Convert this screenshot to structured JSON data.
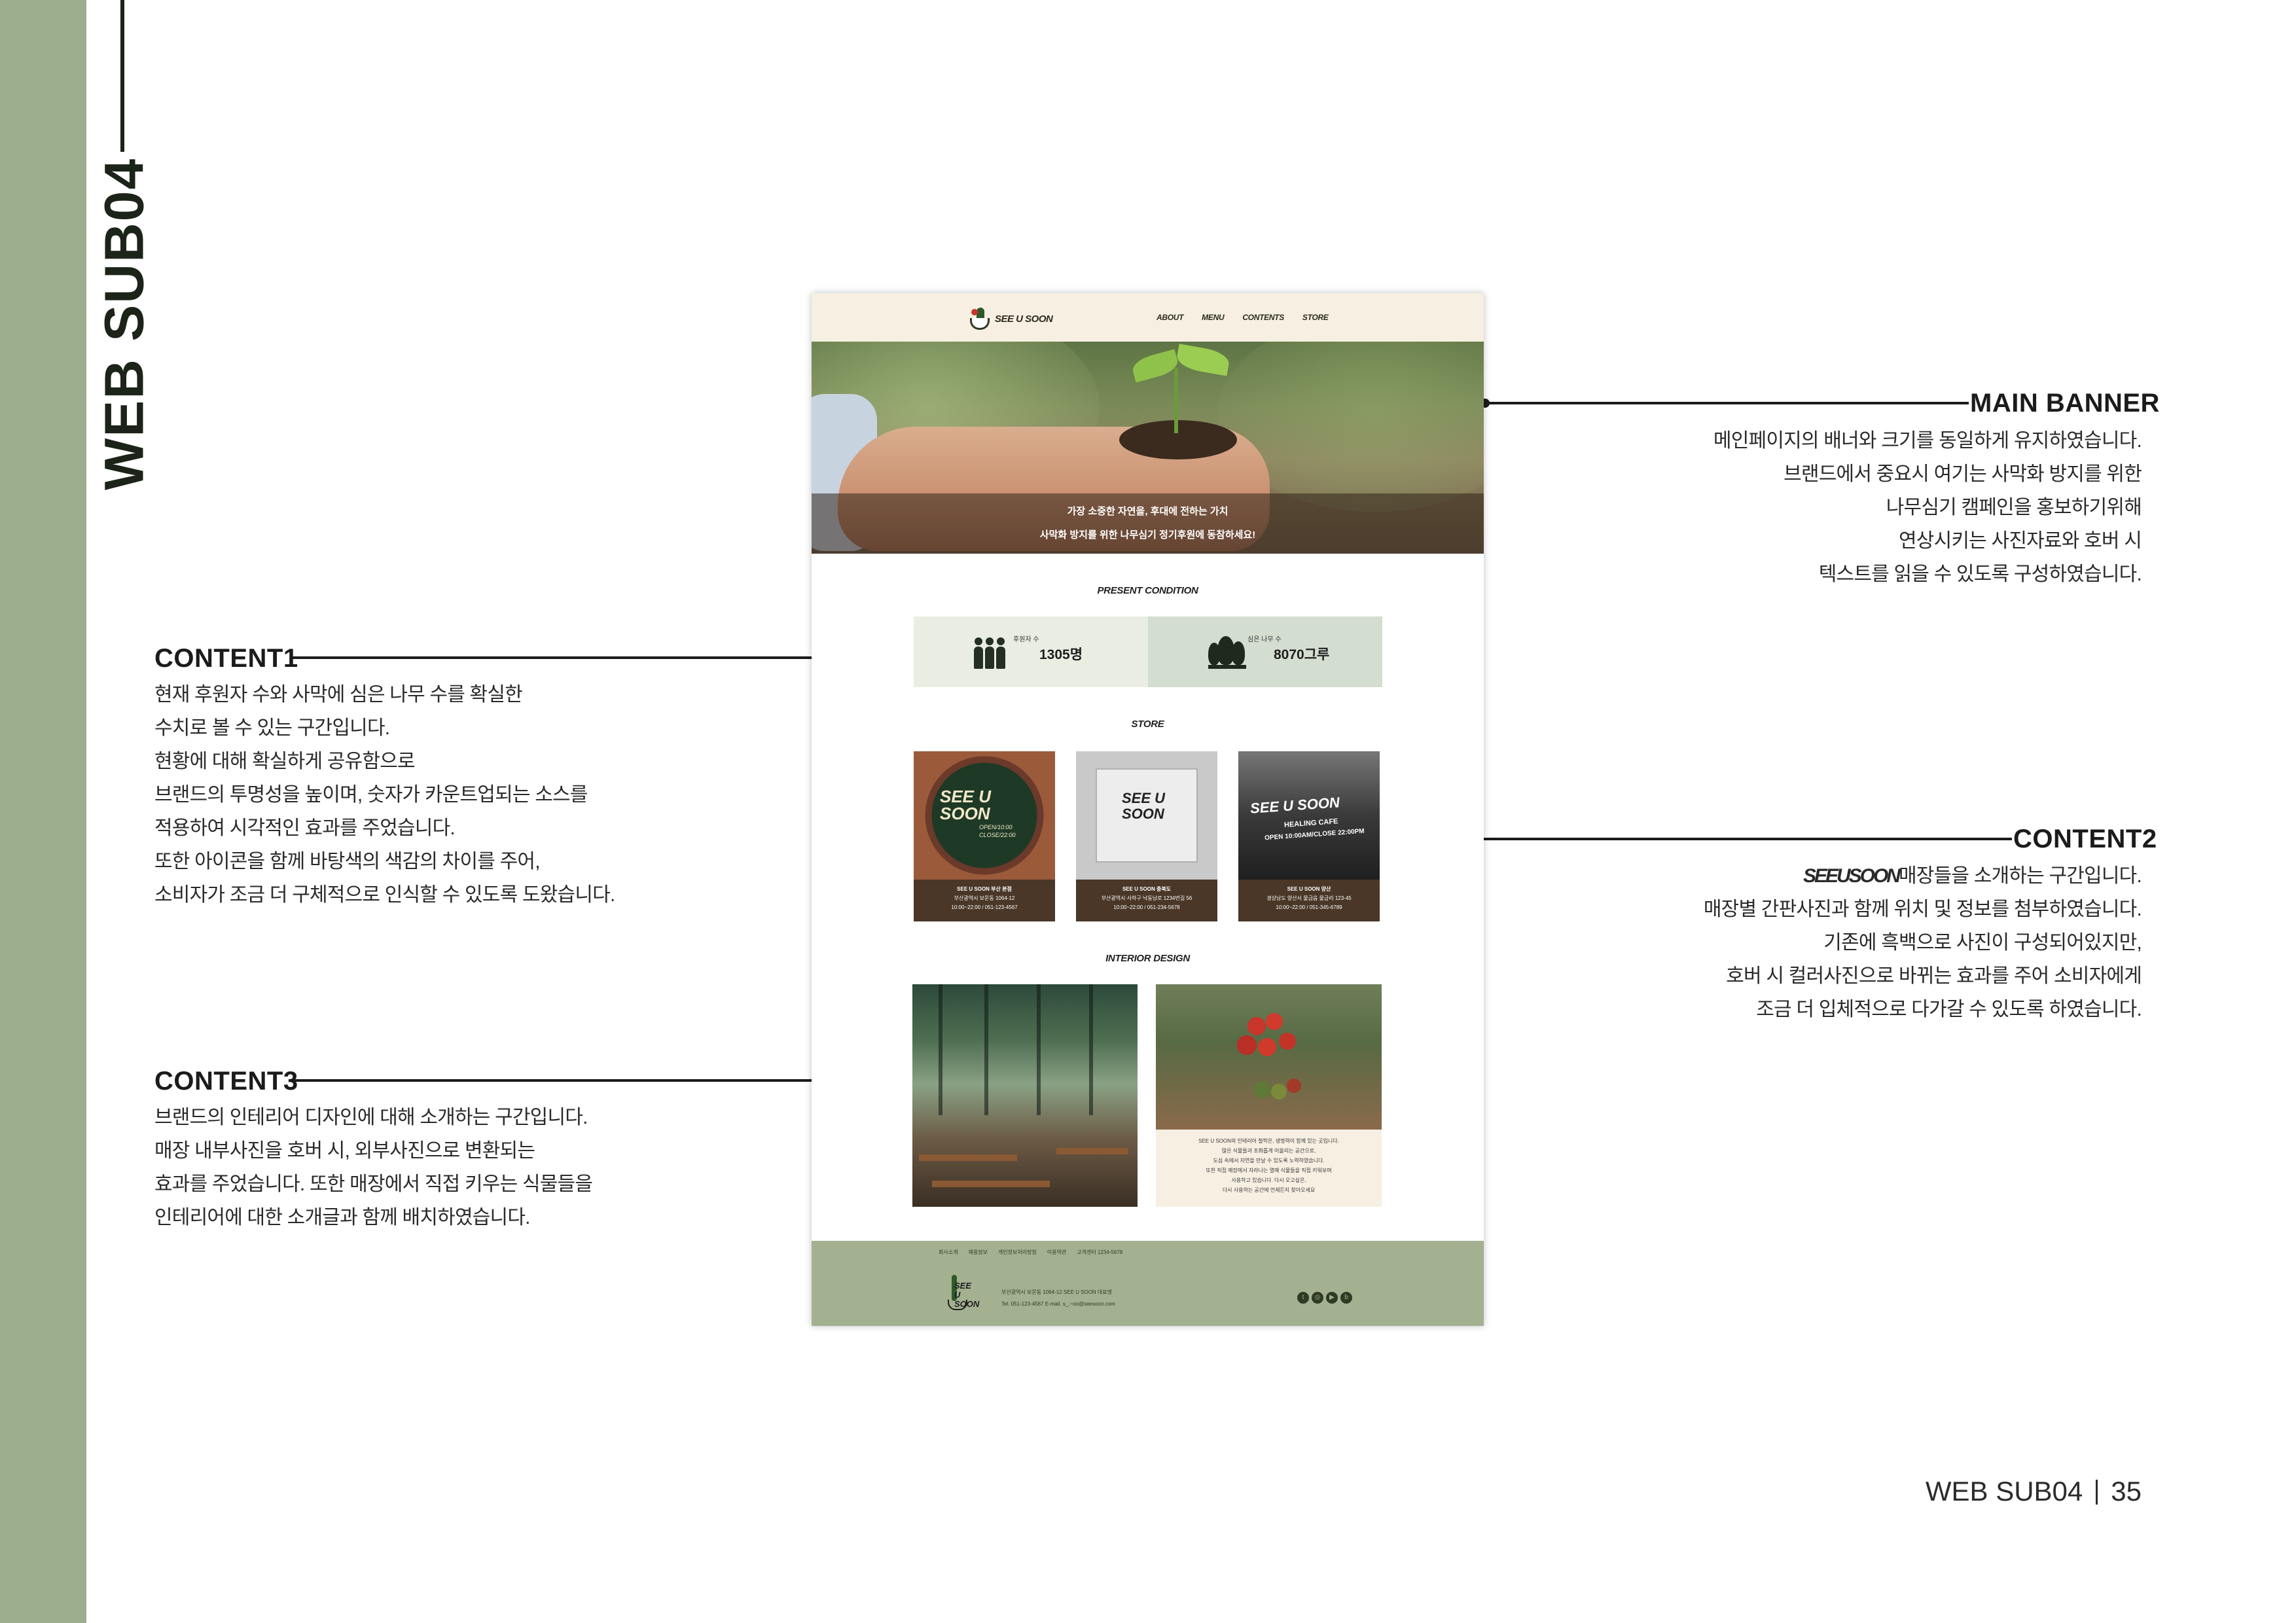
{
  "sidebar": {
    "title": "WEB SUB04"
  },
  "annotations": {
    "main_banner": {
      "title": "MAIN BANNER",
      "lines": [
        "메인페이지의 배너와 크기를 동일하게 유지하였습니다.",
        "브랜드에서 중요시 여기는 사막화 방지를 위한",
        "나무심기 캠페인을 홍보하기위해",
        "연상시키는 사진자료와 호버 시",
        "텍스트를 읽을 수 있도록 구성하였습니다."
      ]
    },
    "content1": {
      "title": "CONTENT1",
      "lines": [
        "현재 후원자 수와 사막에 심은 나무 수를 확실한",
        "수치로 볼 수 있는 구간입니다.",
        "현황에 대해 확실하게 공유함으로",
        "브랜드의 투명성을 높이며, 숫자가 카운트업되는 소스를",
        "적용하여 시각적인 효과를  주었습니다.",
        "또한 아이콘을 함께 바탕색의 색감의 차이를 주어,",
        "소비자가 조금 더 구체적으로 인식할 수 있도록 도왔습니다."
      ]
    },
    "content2": {
      "title": "CONTENT2",
      "brand": "SEEUSOON",
      "first_line_rest": "매장들을 소개하는 구간입니다.",
      "lines": [
        "매장별 간판사진과 함께 위치 및 정보를 첨부하였습니다.",
        "기존에 흑백으로 사진이 구성되어있지만,",
        "호버 시 컬러사진으로 바뀌는 효과를 주어 소비자에게",
        "조금 더 입체적으로 다가갈 수 있도록 하였습니다."
      ]
    },
    "content3": {
      "title": "CONTENT3",
      "lines": [
        "브랜드의 인테리어 디자인에 대해 소개하는 구간입니다.",
        "매장 내부사진을 호버 시, 외부사진으로 변환되는",
        "효과를 주었습니다. 또한 매장에서 직접 키우는 식물들을",
        "인테리어에 대한 소개글과 함께 배치하였습니다."
      ]
    }
  },
  "page_footer": {
    "label": "WEB SUB04",
    "page": "35"
  },
  "mockup": {
    "logo": "SEE U SOON",
    "menu": [
      "ABOUT",
      "MENU",
      "CONTENTS",
      "STORE"
    ],
    "banner": {
      "line1": "가장 소중한 자연을, 후대에 전하는 가치",
      "line2": "사막화 방지를 위한 나무심기 정기후원에 동참하세요!"
    },
    "present": {
      "title": "PRESENT CONDITION",
      "supporters_label": "후원자 수",
      "supporters_value": "1305명",
      "trees_label": "심은 나무 수",
      "trees_value": "8070그루"
    },
    "store": {
      "title": "STORE",
      "cards": [
        {
          "sign_text": "SEE U SOON",
          "sign_sub": "OPEN/10:00 CLOSE/22:00",
          "name": "SEE U SOON  부산 본점",
          "address": "부산광역시 보문동 1064-12",
          "hours": "10:00~22:00 / 051-123-4567"
        },
        {
          "sign_text": "SEE U SOON",
          "name": "SEE U SOON  충북도",
          "address": "부산광역시 사하구 낙동남로 1234번길 56",
          "hours": "10:00~22:00 / 051-234-5678"
        },
        {
          "sign_text": "SEE U SOON",
          "sign_sub": "HEALING CAFE",
          "sign_hours": "OPEN 10:00AM/CLOSE 22:00PM",
          "name": "SEE U SOON  양산",
          "address": "경상남도 양산시 물금읍 물금리 123-45",
          "hours": "10:00~22:00 / 051-345-6789"
        }
      ]
    },
    "interior": {
      "title": "INTERIOR DESIGN",
      "text_lines": [
        "SEE U SOON의 인테리어 철학은, 생명력이 함께 있는 곳입니다.",
        "많은 식물들과 조화롭게 어울리는 공간으로,",
        "도심 속에서 자연을 만날 수 있도록 노력하였습니다.",
        "또한 직접 매장에서 자라나는 열매 식물들을 직접 키워보며",
        "사용하고 있습니다. 다시 오고싶은,",
        "다시 사용하는 공간에 언제든지 찾아오세요"
      ]
    },
    "footer": {
      "links": [
        "회사소개",
        "채용정보",
        "개인정보처리방침",
        "이용약관",
        "고객센터 1234-5678"
      ],
      "logo": "SEE U SOON",
      "addr_line1": "부산광역시 보문동 1064-12     SEE U SOON 대표명",
      "addr_line2": "Tel. 051-123-4567     E-mail. s_.~oo@seesoon.com",
      "social_icons": [
        "twitter-icon",
        "instagram-icon",
        "youtube-icon",
        "blog-icon"
      ]
    }
  }
}
